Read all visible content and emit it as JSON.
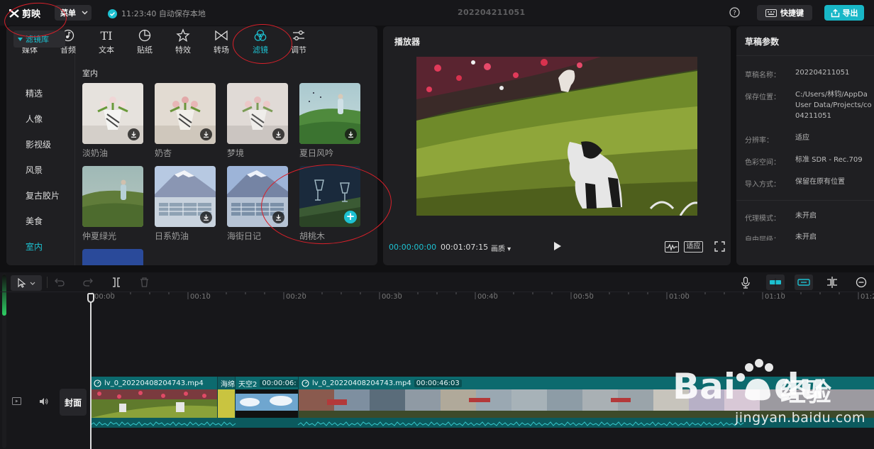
{
  "app": {
    "name": "剪映",
    "menu_label": "菜单",
    "autosave_text": "11:23:40 自动保存本地",
    "project_title": "202204211051",
    "shortcut_label": "快捷键",
    "export_label": "导出"
  },
  "tool_tabs": [
    {
      "label": "媒体",
      "icon": "media-icon"
    },
    {
      "label": "音频",
      "icon": "audio-icon"
    },
    {
      "label": "文本",
      "icon": "text-icon"
    },
    {
      "label": "贴纸",
      "icon": "sticker-icon"
    },
    {
      "label": "特效",
      "icon": "effects-icon"
    },
    {
      "label": "转场",
      "icon": "transition-icon"
    },
    {
      "label": "滤镜",
      "icon": "filter-icon",
      "active": true
    },
    {
      "label": "调节",
      "icon": "adjust-icon"
    }
  ],
  "side_nav": {
    "header": "滤镜库",
    "items": [
      "精选",
      "人像",
      "影视级",
      "风景",
      "复古胶片",
      "美食",
      "室内"
    ],
    "active": "室内"
  },
  "filters": {
    "section_title": "室内",
    "items": [
      {
        "name": "淡奶油",
        "status": "download"
      },
      {
        "name": "奶杏",
        "status": "download"
      },
      {
        "name": "梦境",
        "status": "download"
      },
      {
        "name": "夏日风吟",
        "status": "download"
      },
      {
        "name": "仲夏绿光",
        "status": "download"
      },
      {
        "name": "日系奶油",
        "status": "download"
      },
      {
        "name": "海街日记",
        "status": "download"
      },
      {
        "name": "胡桃木",
        "status": "add"
      }
    ]
  },
  "player": {
    "title": "播放器",
    "current_time": "00:00:00:00",
    "total_time": "00:01:07:15",
    "quality_label": "画质",
    "fit_label": "适应"
  },
  "draft": {
    "title": "草稿参数",
    "rows": [
      {
        "label": "草稿名称：",
        "value": [
          "202204211051"
        ]
      },
      {
        "label": "保存位置：",
        "value": [
          "C:/Users/林钧/AppDa",
          "User Data/Projects/co",
          "04211051"
        ]
      },
      {
        "label": "分辨率：",
        "value": [
          "适应"
        ]
      },
      {
        "label": "色彩空间：",
        "value": [
          "标准 SDR - Rec.709"
        ]
      },
      {
        "label": "导入方式：",
        "value": [
          "保留在原有位置"
        ]
      },
      {
        "label": "代理模式：",
        "value": [
          "未开启"
        ]
      },
      {
        "label": "自由层级：",
        "value": [
          "未开启"
        ]
      }
    ]
  },
  "timeline": {
    "ruler_labels": [
      "00:00",
      "00:10",
      "00:20",
      "00:30",
      "00:40",
      "00:50",
      "01:00",
      "01:10",
      "01:20"
    ],
    "cover_label": "封面",
    "clips": [
      {
        "name": "lv_0_20220408204743.mp4",
        "duration": ""
      },
      {
        "name": "海绵",
        "duration": ""
      },
      {
        "name": "天空2",
        "duration": "00:00:06:"
      },
      {
        "name": "lv_0_20220408204743.mp4",
        "duration": "00:00:46:03"
      }
    ]
  },
  "watermark": {
    "brand": "Bai",
    "brand_suffix": "du",
    "product": "经验",
    "url": "jingyan.baidu.com"
  },
  "colors": {
    "accent": "#1dc1d1",
    "clip": "#0c6a6e",
    "annotation": "#d8202a"
  }
}
